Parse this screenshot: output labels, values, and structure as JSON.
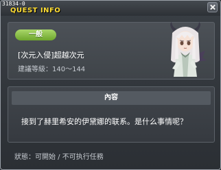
{
  "window": {
    "quest_id": "31834-0",
    "title": "QUEST INFO",
    "close_icon": "close-icon"
  },
  "info": {
    "badge": "一般",
    "quest_name": "[次元入侵]超越次元",
    "level_label": "建議等級：",
    "level_range": "140～144",
    "npc_icon": "npc-portrait"
  },
  "content": {
    "header": "內容",
    "text": "接到了赫里希安的伊黛娜的联系。是什么事情呢？"
  },
  "status": {
    "label": "狀態：",
    "value": "可開始 / 不可执行任務"
  },
  "colors": {
    "title": "#ffdd33",
    "badge": "#8cc04a",
    "text": "#ffffff",
    "muted": "#c7ccd2"
  }
}
